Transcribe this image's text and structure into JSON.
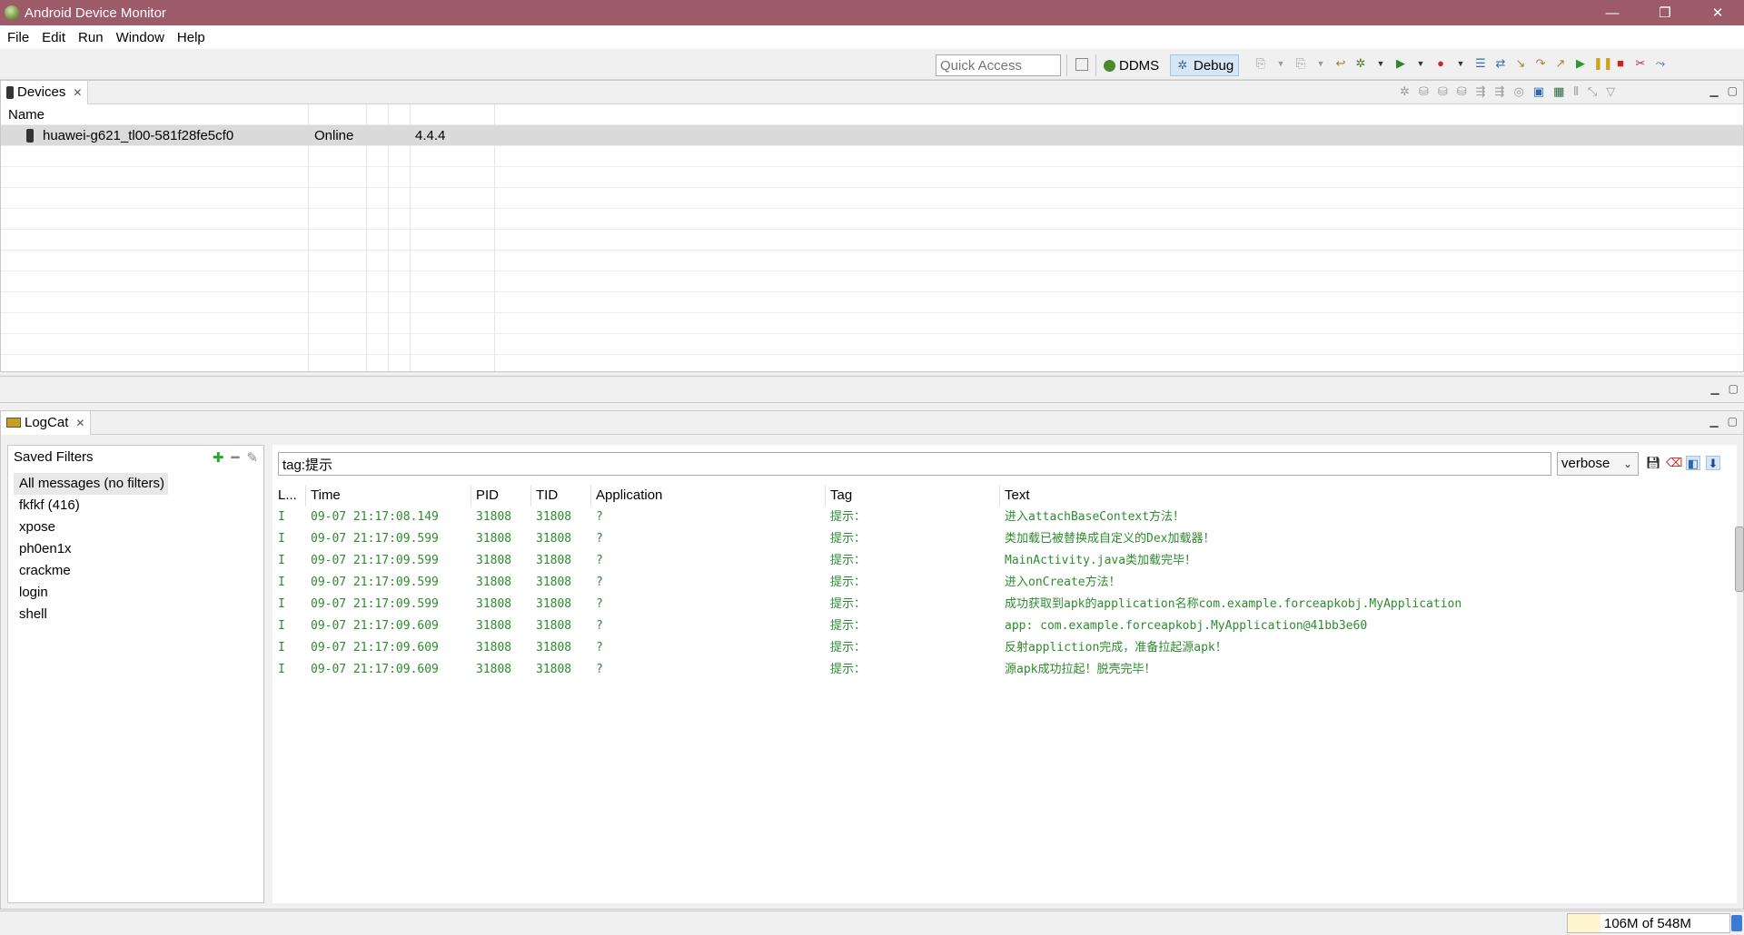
{
  "window": {
    "title": "Android Device Monitor",
    "controls": [
      "—",
      "❐",
      "✕"
    ]
  },
  "menubar": {
    "items": [
      "File",
      "Edit",
      "Run",
      "Window",
      "Help"
    ]
  },
  "toolbar": {
    "quick_access_placeholder": "Quick Access",
    "perspectives": [
      {
        "label": "DDMS",
        "icon": "android-icon"
      },
      {
        "label": "Debug",
        "icon": "bug-icon",
        "active": true
      }
    ]
  },
  "devices": {
    "tab_label": "Devices",
    "columns": [
      "Name",
      "",
      "",
      "",
      ""
    ],
    "rows": [
      {
        "name": "huawei-g621_tl00-581f28fe5cf0",
        "status": "Online",
        "version": "4.4.4"
      }
    ]
  },
  "logcat": {
    "tab_label": "LogCat",
    "filters": {
      "title": "Saved Filters",
      "items": [
        "All messages (no filters)",
        "fkfkf (416)",
        "xpose",
        "ph0en1x",
        "crackme",
        "login",
        "shell"
      ],
      "selected_index": 0
    },
    "search_value": "tag:提示",
    "level": "verbose",
    "columns": [
      "L...",
      "Time",
      "PID",
      "TID",
      "Application",
      "Tag",
      "Text"
    ],
    "rows": [
      {
        "level": "I",
        "time": "09-07 21:17:08.149",
        "pid": "31808",
        "tid": "31808",
        "app": "?",
        "tag": "提示：",
        "text": "进入attachBaseContext方法！"
      },
      {
        "level": "I",
        "time": "09-07 21:17:09.599",
        "pid": "31808",
        "tid": "31808",
        "app": "?",
        "tag": "提示：",
        "text": "类加载已被替换成自定义的Dex加载器！"
      },
      {
        "level": "I",
        "time": "09-07 21:17:09.599",
        "pid": "31808",
        "tid": "31808",
        "app": "?",
        "tag": "提示：",
        "text": "MainActivity.java类加载完毕！"
      },
      {
        "level": "I",
        "time": "09-07 21:17:09.599",
        "pid": "31808",
        "tid": "31808",
        "app": "?",
        "tag": "提示：",
        "text": "进入onCreate方法！"
      },
      {
        "level": "I",
        "time": "09-07 21:17:09.599",
        "pid": "31808",
        "tid": "31808",
        "app": "?",
        "tag": "提示：",
        "text": "成功获取到apk的application名称com.example.forceapkobj.MyApplication"
      },
      {
        "level": "I",
        "time": "09-07 21:17:09.609",
        "pid": "31808",
        "tid": "31808",
        "app": "?",
        "tag": "提示：",
        "text": "app: com.example.forceapkobj.MyApplication@41bb3e60"
      },
      {
        "level": "I",
        "time": "09-07 21:17:09.609",
        "pid": "31808",
        "tid": "31808",
        "app": "?",
        "tag": "提示：",
        "text": "反射appliction完成，准备拉起源apk！"
      },
      {
        "level": "I",
        "time": "09-07 21:17:09.609",
        "pid": "31808",
        "tid": "31808",
        "app": "?",
        "tag": "提示：",
        "text": "源apk成功拉起！脱壳完毕！"
      }
    ],
    "log_color": "#2e8b2e"
  },
  "status": {
    "memory": "106M of 548M"
  },
  "colors": {
    "titlebar": "#9d5b6a",
    "selection": "#dadada"
  }
}
